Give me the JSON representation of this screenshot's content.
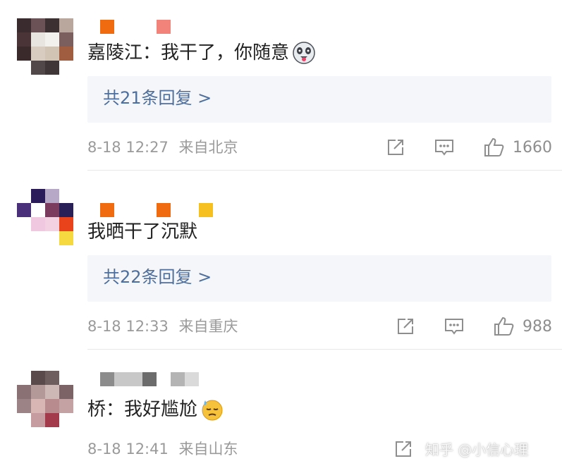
{
  "comments": [
    {
      "text": "嘉陵江：我干了，你随意",
      "emoji": "panda-tongue-emoji",
      "replies": "共21条回复 >",
      "time": "8-18 12:27",
      "location": "来自北京",
      "likes": "1660"
    },
    {
      "text": "我晒干了沉默",
      "replies": "共22条回复 >",
      "time": "8-18 12:33",
      "location": "来自重庆",
      "likes": "988"
    },
    {
      "text": "桥：我好尴尬",
      "emoji": "sweat-emoji",
      "time": "8-18 12:41",
      "location": "来自山东"
    }
  ],
  "watermark": "知乎 @小信心理",
  "colors": {
    "reply_link": "#4e6e9b",
    "meta_gray": "#9a9a9a",
    "reply_bg": "#f4f6f9",
    "icon_gray": "#8e8e8e"
  },
  "icons": [
    "share-icon",
    "comment-icon",
    "like-icon"
  ]
}
